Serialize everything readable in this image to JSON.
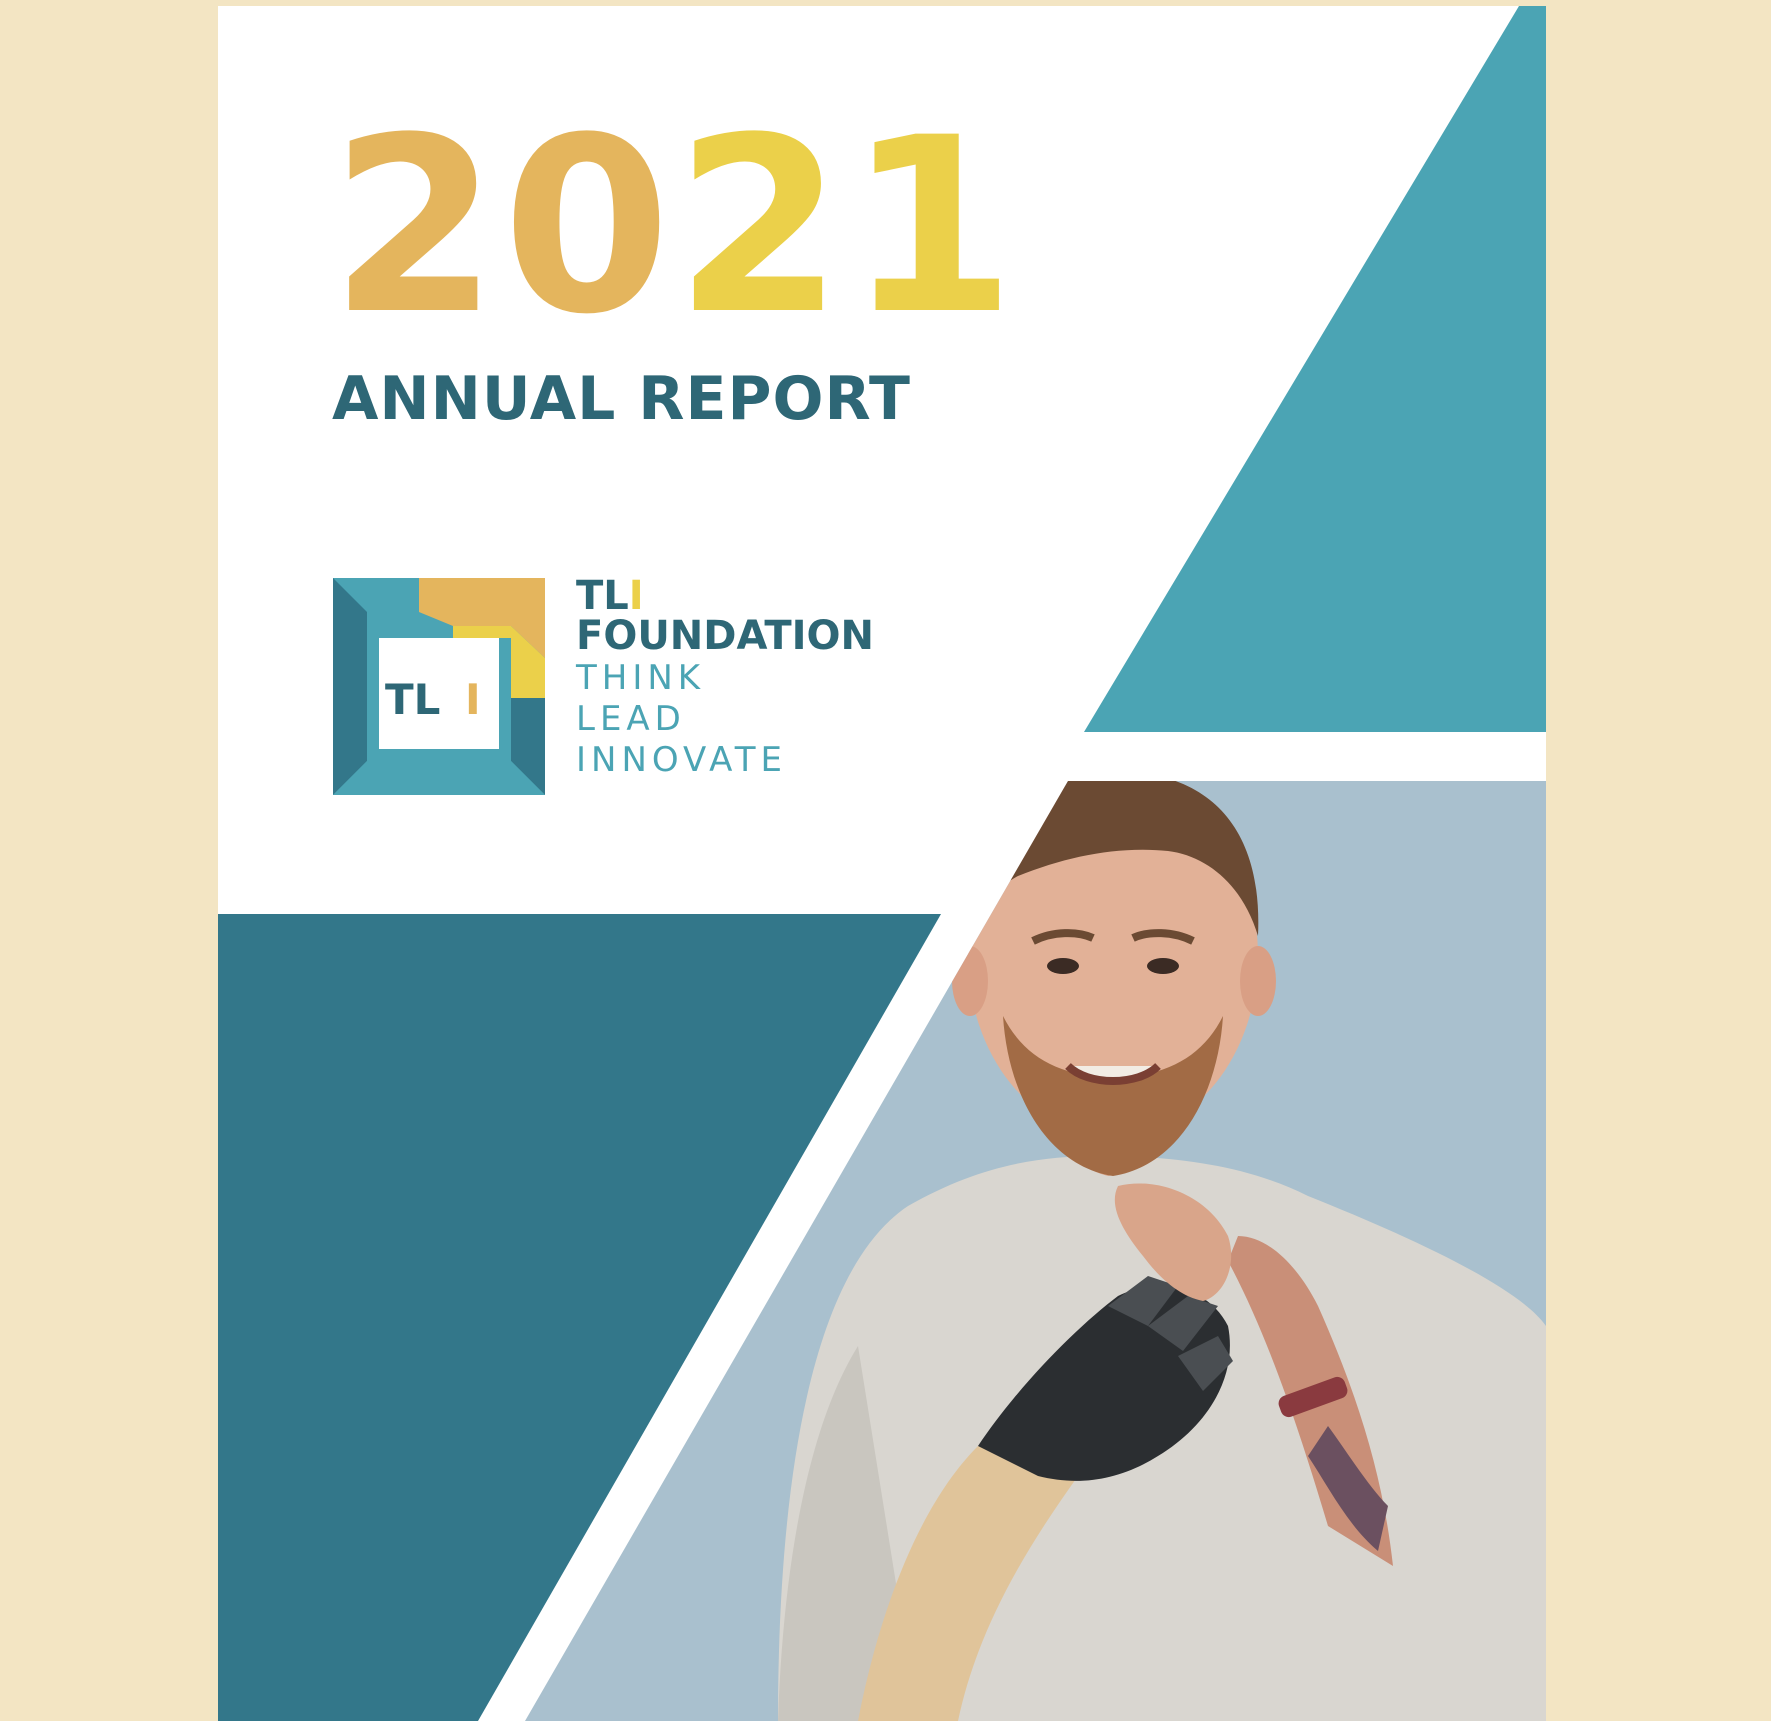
{
  "cover": {
    "year_part1": "20",
    "year_part2": "21",
    "title": "ANNUAL REPORT"
  },
  "logo": {
    "mark_text_main": "TL",
    "mark_text_accent": "I",
    "name_main": "TL",
    "name_accent": "I",
    "name_line2": "FOUNDATION",
    "tagline": [
      "THINK",
      "LEAD",
      "INNOVATE"
    ]
  },
  "colors": {
    "background": "#f3e5c3",
    "teal_light": "#4ba4b4",
    "teal_dark": "#33778a",
    "gold": "#e4b55d",
    "yellow": "#ebd04a",
    "navy_teal": "#2e6776",
    "photo_backdrop": "#a9c0ce"
  },
  "photo": {
    "icon": "person-with-prosthetic-hand-photo"
  }
}
